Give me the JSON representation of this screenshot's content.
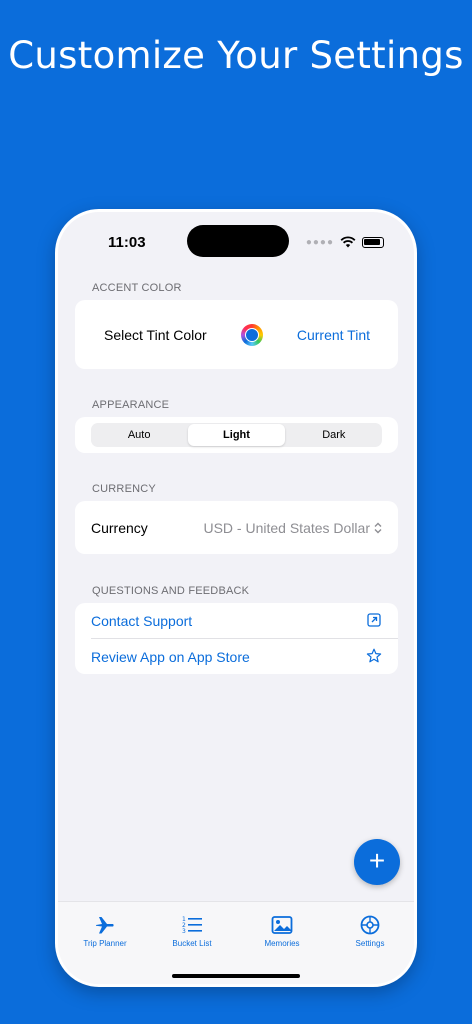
{
  "promo": {
    "headline": "Customize Your Settings"
  },
  "status_bar": {
    "time": "11:03"
  },
  "accent_color": {
    "header": "ACCENT COLOR",
    "label": "Select Tint Color",
    "current": "Current Tint",
    "tint_color": "#0b6ddb"
  },
  "appearance": {
    "header": "APPEARANCE",
    "options": [
      "Auto",
      "Light",
      "Dark"
    ],
    "selected": "Light"
  },
  "currency": {
    "header": "CURRENCY",
    "label": "Currency",
    "value": "USD - United States Dollar"
  },
  "feedback": {
    "header": "QUESTIONS AND FEEDBACK",
    "items": [
      {
        "label": "Contact Support",
        "icon": "external-link-icon"
      },
      {
        "label": "Review App on App Store",
        "icon": "star-icon"
      }
    ]
  },
  "fab": {
    "label": "+"
  },
  "tabbar": {
    "tabs": [
      {
        "label": "Trip Planner",
        "icon": "airplane-icon"
      },
      {
        "label": "Bucket List",
        "icon": "list-icon"
      },
      {
        "label": "Memories",
        "icon": "photo-icon"
      },
      {
        "label": "Settings",
        "icon": "gear-icon"
      }
    ]
  },
  "colors": {
    "accent": "#0b6ddb",
    "background": "#f2f2f7",
    "promo_bg": "#0b6ddb"
  }
}
